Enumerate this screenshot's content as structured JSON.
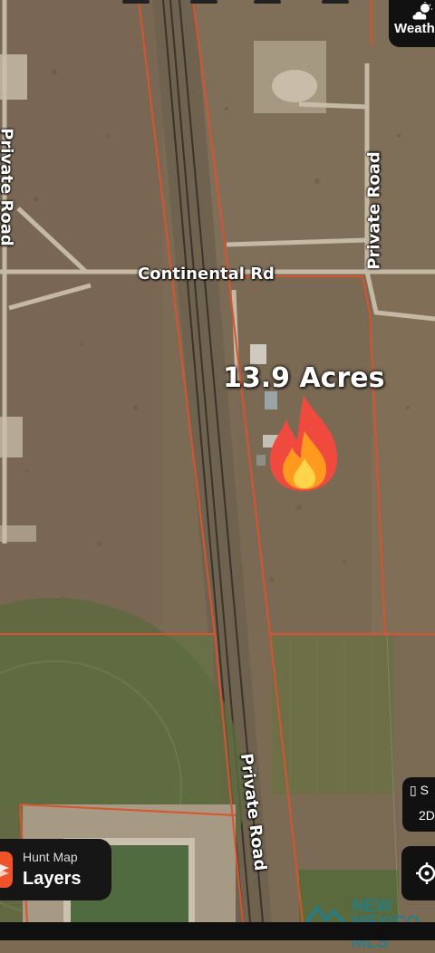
{
  "map": {
    "roads": {
      "continental": "Continental Rd",
      "private_left": "Private Road",
      "private_right": "Private Road",
      "private_bottom": "Private Road"
    },
    "parcel": {
      "acres_label": "13.9 Acres",
      "emoji": "🔥"
    }
  },
  "controls": {
    "weather_label": "Weath",
    "weather_icon": "cloud-sun-icon",
    "hunt_map": {
      "line1": "Hunt Map",
      "line2": "Layers",
      "icon": "layers-icon"
    },
    "side": {
      "line1": "S",
      "line2": "2D"
    },
    "gps_icon": "crosshair-icon"
  },
  "watermark": {
    "line1": "NEW",
    "line2": "MEXICO MLS"
  }
}
